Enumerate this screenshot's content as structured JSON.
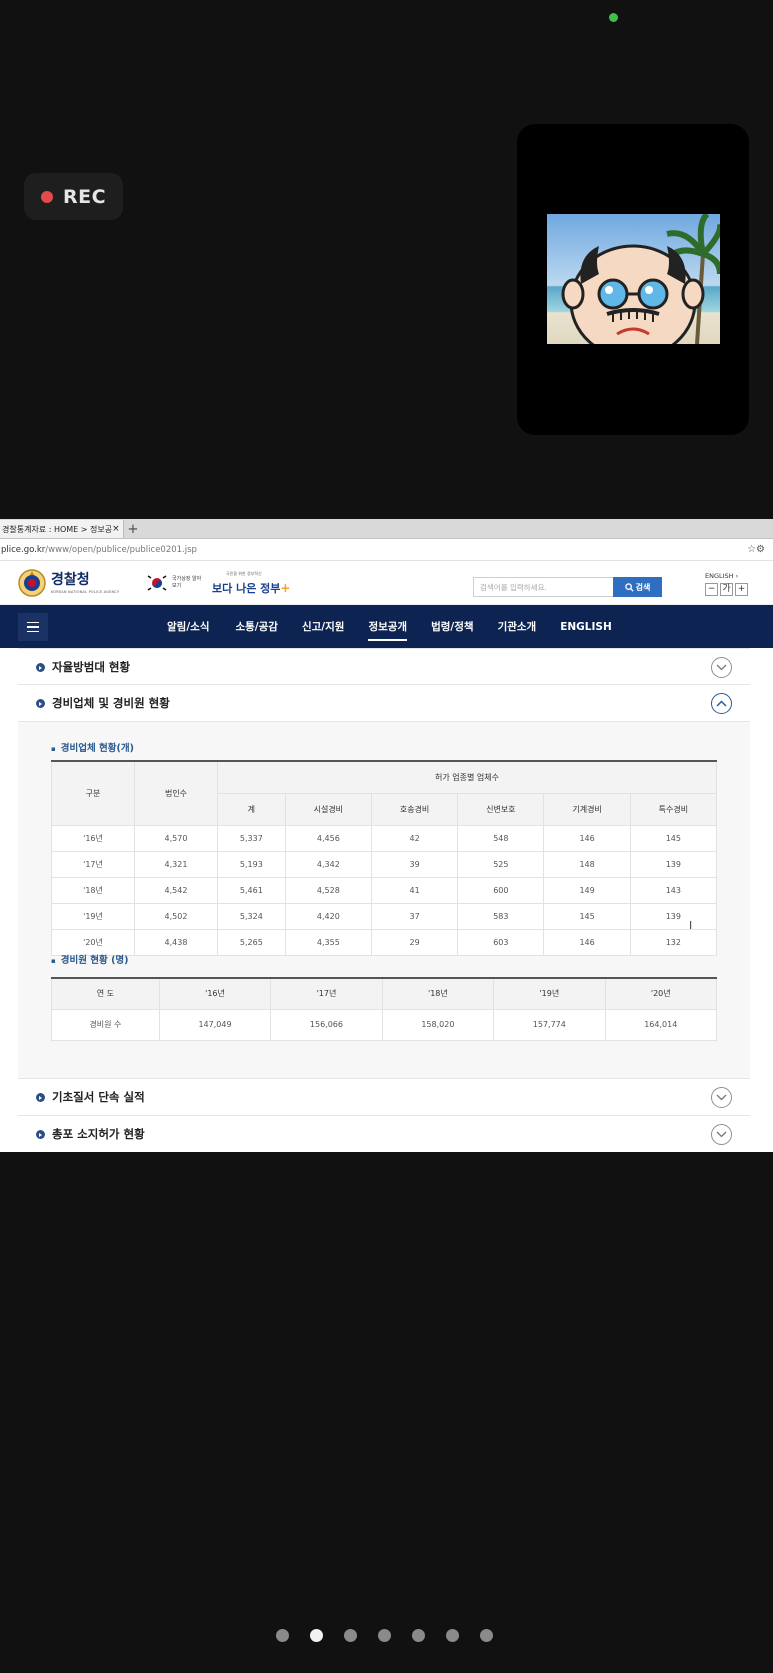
{
  "status": {
    "rec_label": "REC"
  },
  "browser": {
    "tab_title": "경찰통계자료 : HOME > 정보공",
    "tab_close": "×",
    "new_tab": "+",
    "url_dim": "plice.go.kr",
    "url_path": "/www/open/publice/publice0201.jsp"
  },
  "site": {
    "logo_main": "경찰청",
    "logo_sub": "KOREAN NATIONAL POLICE AGENCY",
    "gov_small": "국가상징 알아보기",
    "gov_tiny": "국민을 위한 정부혁신",
    "gov_main": "보다 나은 정부",
    "gov_plus": "+",
    "search_placeholder": "검색어를 입력하세요.",
    "search_button": "검색",
    "english_link": "ENGLISH ›",
    "font_minus": "−",
    "font_reset": "가",
    "font_plus": "+"
  },
  "nav": {
    "items": [
      "알림/소식",
      "소통/공감",
      "신고/지원",
      "정보공개",
      "법령/정책",
      "기관소개",
      "ENGLISH"
    ],
    "active": "정보공개"
  },
  "accordion": {
    "item1": "자율방범대 현황",
    "item2": "경비업체 및 경비원 현황",
    "item3": "기초질서 단속 실적",
    "item4": "총포 소지허가 현황"
  },
  "table1": {
    "title": "경비업체 현황(개)",
    "header_category": "구분",
    "header_corp": "법인수",
    "header_group": "허가 업종별 업체수",
    "sub_headers": [
      "계",
      "시설경비",
      "호송경비",
      "신변보호",
      "기계경비",
      "특수경비"
    ],
    "rows": [
      [
        "'16년",
        "4,570",
        "5,337",
        "4,456",
        "42",
        "548",
        "146",
        "145"
      ],
      [
        "'17년",
        "4,321",
        "5,193",
        "4,342",
        "39",
        "525",
        "148",
        "139"
      ],
      [
        "'18년",
        "4,542",
        "5,461",
        "4,528",
        "41",
        "600",
        "149",
        "143"
      ],
      [
        "'19년",
        "4,502",
        "5,324",
        "4,420",
        "37",
        "583",
        "145",
        "139"
      ],
      [
        "'20년",
        "4,438",
        "5,265",
        "4,355",
        "29",
        "603",
        "146",
        "132"
      ]
    ]
  },
  "table2": {
    "title": "경비원 현황 (명)",
    "header_year": "연 도",
    "years": [
      "'16년",
      "'17년",
      "'18년",
      "'19년",
      "'20년"
    ],
    "row_label": "경비원 수",
    "values": [
      "147,049",
      "156,066",
      "158,020",
      "157,774",
      "164,014"
    ]
  },
  "pager": {
    "count": 7,
    "active_index": 1
  }
}
